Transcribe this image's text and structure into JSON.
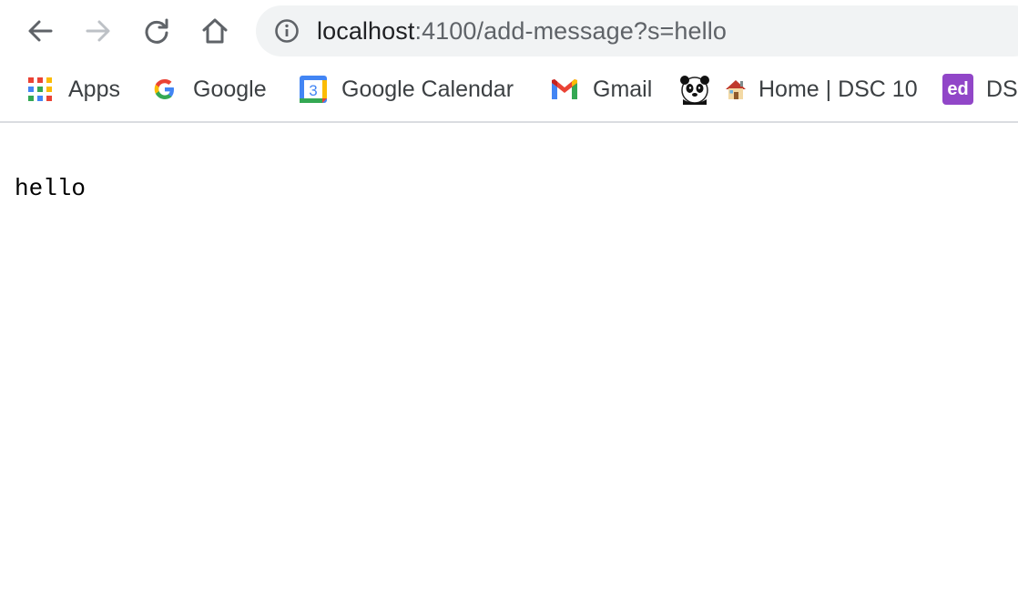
{
  "browser": {
    "url_host": "localhost",
    "url_rest": ":4100/add-message?s=hello",
    "bookmarks": [
      {
        "label": "Apps",
        "icon": "apps-grid-icon"
      },
      {
        "label": "Google",
        "icon": "google-icon"
      },
      {
        "label": "Google Calendar",
        "icon": "google-calendar-icon"
      },
      {
        "label": "Gmail",
        "icon": "gmail-icon"
      },
      {
        "label": "",
        "icon": "panda-icon"
      },
      {
        "label": "Home | DSC 10",
        "icon": "house-icon"
      },
      {
        "label": "DS",
        "icon": "ed-icon"
      }
    ],
    "calendar_day": "3",
    "ed_badge": "ed"
  },
  "page": {
    "message": "hello"
  }
}
